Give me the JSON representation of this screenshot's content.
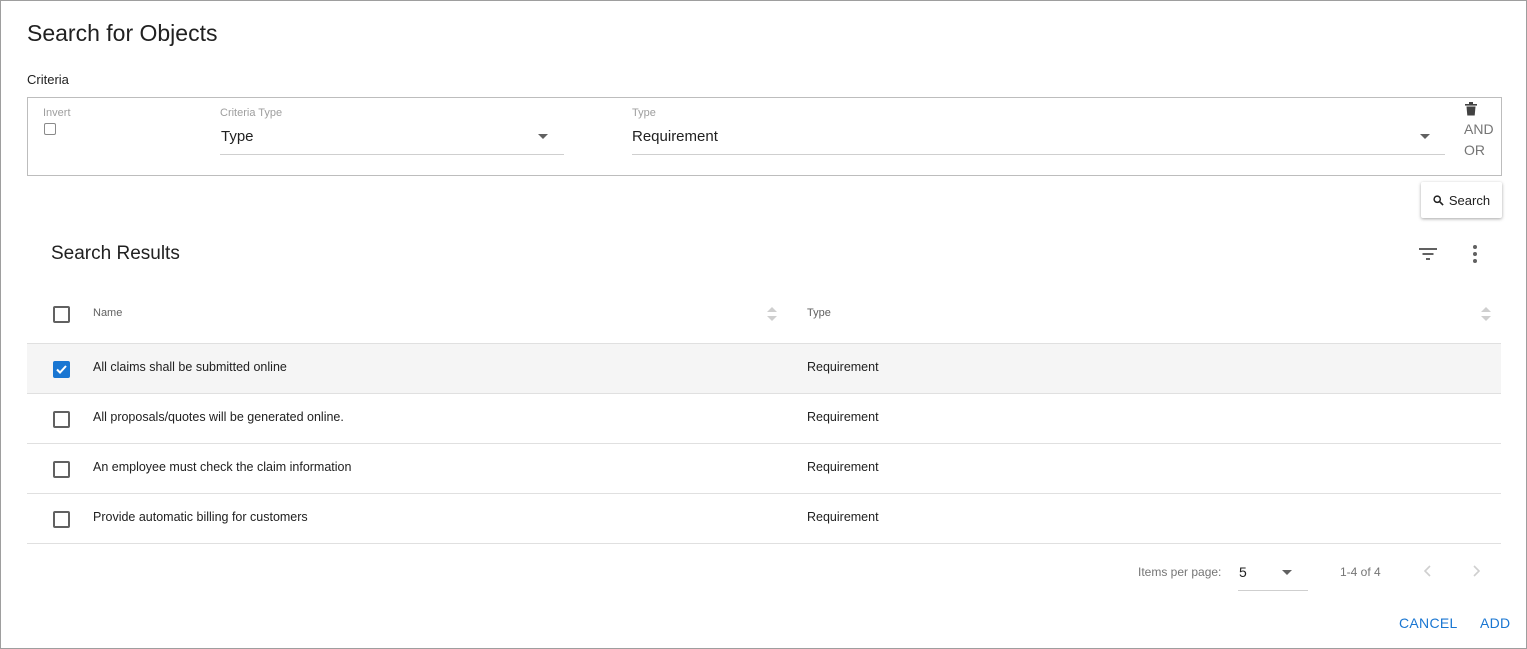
{
  "dialog": {
    "title": "Search for Objects",
    "criteria_label": "Criteria"
  },
  "criteria": {
    "invert_label": "Invert",
    "invert_checked": false,
    "criteria_type_label": "Criteria Type",
    "criteria_type_value": "Type",
    "type_label": "Type",
    "type_value": "Requirement",
    "and_label": "AND",
    "or_label": "OR"
  },
  "search_button": {
    "label": "Search",
    "icon": "search-icon"
  },
  "results": {
    "title": "Search Results",
    "columns": [
      "Name",
      "Type"
    ],
    "rows": [
      {
        "name": "All claims shall be submitted online",
        "type": "Requirement",
        "checked": true
      },
      {
        "name": "All proposals/quotes will be generated online.",
        "type": "Requirement",
        "checked": false
      },
      {
        "name": "An employee must check the claim information",
        "type": "Requirement",
        "checked": false
      },
      {
        "name": "Provide automatic billing for customers",
        "type": "Requirement",
        "checked": false
      }
    ]
  },
  "paginator": {
    "items_per_page_label": "Items per page:",
    "page_size": "5",
    "range_label": "1-4 of 4"
  },
  "actions": {
    "cancel_label": "CANCEL",
    "add_label": "ADD"
  },
  "colors": {
    "accent": "#1976d2",
    "selected_row": "#f5f5f5"
  }
}
